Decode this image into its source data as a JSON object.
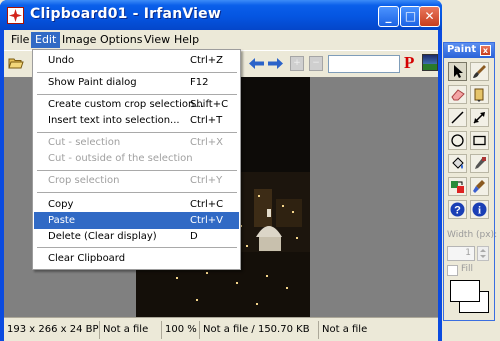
{
  "window": {
    "title": "Clipboard01 - IrfanView",
    "minimize": "_",
    "maximize": "□",
    "close": "✕"
  },
  "menubar": [
    "File",
    "Edit",
    "Image",
    "Options",
    "View",
    "Help"
  ],
  "toolbar": {
    "paint_button": "P",
    "zoom_in": "+",
    "zoom_out": "−"
  },
  "edit_menu": {
    "items": [
      {
        "label": "Undo",
        "shortcut": "Ctrl+Z",
        "enabled": true
      },
      {
        "label": "Show Paint dialog",
        "shortcut": "F12",
        "enabled": true
      },
      {
        "label": "Create custom crop selection...",
        "shortcut": "Shift+C",
        "enabled": true
      },
      {
        "label": "Insert text into selection...",
        "shortcut": "Ctrl+T",
        "enabled": true
      },
      {
        "label": "Cut - selection",
        "shortcut": "Ctrl+X",
        "enabled": false
      },
      {
        "label": "Cut - outside of the selection",
        "shortcut": "",
        "enabled": false
      },
      {
        "label": "Crop selection",
        "shortcut": "Ctrl+Y",
        "enabled": false
      },
      {
        "label": "Copy",
        "shortcut": "Ctrl+C",
        "enabled": true
      },
      {
        "label": "Paste",
        "shortcut": "Ctrl+V",
        "enabled": true,
        "highlighted": true
      },
      {
        "label": "Delete (Clear display)",
        "shortcut": "D",
        "enabled": true
      },
      {
        "label": "Clear Clipboard",
        "shortcut": "",
        "enabled": true
      }
    ]
  },
  "statusbar": [
    "193 x 266 x 24 BPP",
    "Not a file",
    "100 %",
    "Not a file / 150.70 KB",
    "Not a file"
  ],
  "paint": {
    "title": "Paint",
    "close": "x",
    "tools": [
      "select-arrow",
      "brush",
      "eraser",
      "color-picker-pen",
      "line",
      "arrow-line",
      "ellipse",
      "rectangle",
      "fill-bucket",
      "dropper",
      "color-replace",
      "clone-stamp",
      "help",
      "info"
    ],
    "width_label": "Width (px):",
    "width_value": "1",
    "fill_label": "Fill"
  },
  "colors": {
    "titlebar": "#0555e1",
    "menu_highlight": "#316ac5",
    "paint_red": "#d40000"
  }
}
